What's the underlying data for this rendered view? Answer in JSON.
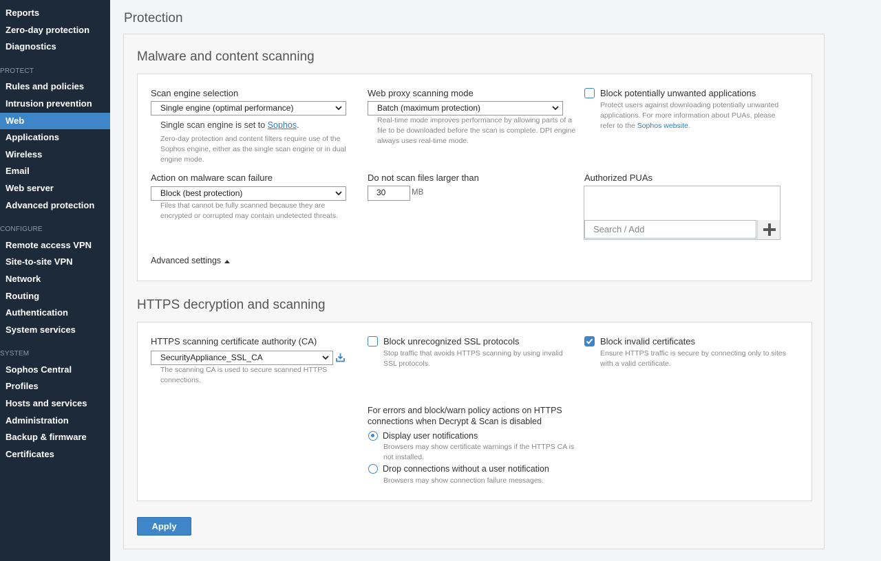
{
  "sidebar": {
    "items_top": [
      {
        "label": "Reports"
      },
      {
        "label": "Zero-day protection"
      },
      {
        "label": "Diagnostics"
      }
    ],
    "protect_heading": "PROTECT",
    "protect_items": [
      {
        "label": "Rules and policies"
      },
      {
        "label": "Intrusion prevention"
      },
      {
        "label": "Web"
      },
      {
        "label": "Applications"
      },
      {
        "label": "Wireless"
      },
      {
        "label": "Email"
      },
      {
        "label": "Web server"
      },
      {
        "label": "Advanced protection"
      }
    ],
    "configure_heading": "CONFIGURE",
    "configure_items": [
      {
        "label": "Remote access VPN"
      },
      {
        "label": "Site-to-site VPN"
      },
      {
        "label": "Network"
      },
      {
        "label": "Routing"
      },
      {
        "label": "Authentication"
      },
      {
        "label": "System services"
      }
    ],
    "system_heading": "SYSTEM",
    "system_items": [
      {
        "label": "Sophos Central"
      },
      {
        "label": "Profiles"
      },
      {
        "label": "Hosts and services"
      },
      {
        "label": "Administration"
      },
      {
        "label": "Backup & firmware"
      },
      {
        "label": "Certificates"
      }
    ],
    "active_item": "Web"
  },
  "page_title": "Protection",
  "malware": {
    "title": "Malware and content scanning",
    "scan_engine_label": "Scan engine selection",
    "scan_engine_value": "Single engine (optimal performance)",
    "scan_engine_note_prefix": "Single scan engine is set to",
    "scan_engine_note_link": "Sophos",
    "scan_engine_note_suffix": ".",
    "scan_engine_help": "Zero-day protection and content filters require use of the Sophos engine, either as the single scan engine or in dual engine mode.",
    "proxy_mode_label": "Web proxy scanning mode",
    "proxy_mode_value": "Batch (maximum protection)",
    "proxy_mode_help": "Real-time mode improves performance by allowing parts of a file to be downloaded before the scan is complete. DPI engine always uses real-time mode.",
    "pua_label": "Block potentially unwanted applications",
    "pua_help_text": "Protect users against downloading potentially unwanted applications. For more information about PUAs, please refer to the",
    "pua_help_link": "Sophos website",
    "pua_help_end": ".",
    "failure_label": "Action on malware scan failure",
    "failure_value": "Block (best protection)",
    "failure_help": "Files that cannot be fully scanned because they are encrypted or corrupted may contain undetected threats.",
    "max_size_label": "Do not scan files larger than",
    "max_size_value": "30",
    "max_size_unit": "MB",
    "authorized_puas_label": "Authorized PUAs",
    "search_placeholder": "Search / Add",
    "advanced_settings": "Advanced settings"
  },
  "https": {
    "title": "HTTPS decryption and scanning",
    "ca_label": "HTTPS scanning certificate authority (CA)",
    "ca_value": "SecurityAppliance_SSL_CA",
    "ca_help": "The scanning CA is used to secure scanned HTTPS connections.",
    "block_ssl_label": "Block unrecognized SSL protocols",
    "block_ssl_help": "Stop traffic that avoids HTTPS scanning by using invalid SSL protocols.",
    "block_invalid_label": "Block invalid certificates",
    "block_invalid_help": "Ensure HTTPS traffic is secure by connecting only to sites with a valid certificate.",
    "errors_heading_1": "For errors and block/warn policy actions on HTTPS",
    "errors_heading_2": "connections when Decrypt & Scan is disabled",
    "option1_label": "Display user notifications",
    "option1_help": "Browsers may show certificate warnings if the HTTPS CA is not installed.",
    "option2_label": "Drop connections without a user notification",
    "option2_help": "Browsers may show connection failure messages."
  },
  "apply_label": "Apply",
  "colors": {
    "sidebar_bg": "#1c2a39",
    "accent": "#3f86c8"
  }
}
